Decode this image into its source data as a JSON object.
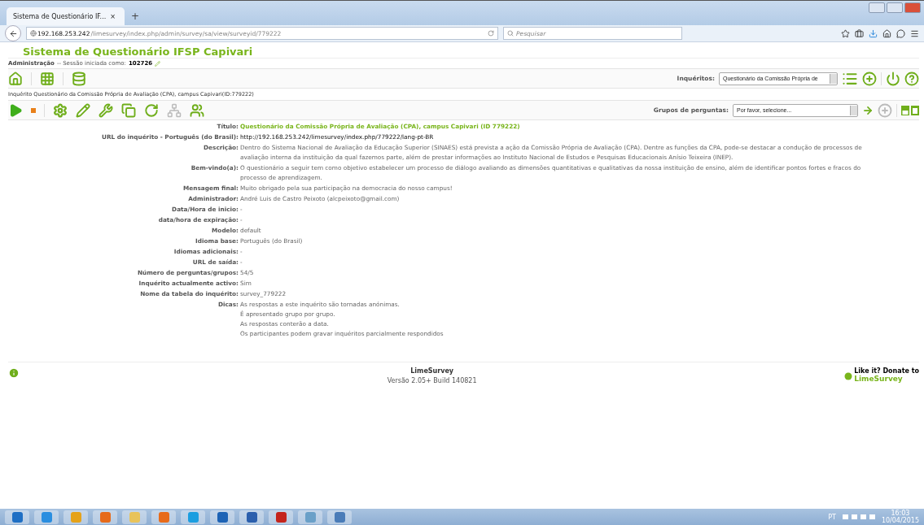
{
  "browser": {
    "tab_title": "Sistema de Questionário IF...",
    "tab_close": "×",
    "new_tab": "+",
    "url_host": "192.168.253.242",
    "url_path": "/limesurvey/index.php/admin/survey/sa/view/surveyid/779222",
    "search_placeholder": "Pesquisar"
  },
  "header": {
    "title": "Sistema de Questionário IFSP Capivari",
    "admin_label": "Administração",
    "session_text": "-- Sessão iniciada como:",
    "user": "102726"
  },
  "surveys": {
    "label": "Inquéritos:",
    "value": "Questionário da Comissão Própria de"
  },
  "survey_line": "Inquérito Questionário da Comissão Própria de Avaliação (CPA), campus Capivari(ID:779222)",
  "groups": {
    "label": "Grupos de perguntas:",
    "value": "Por favor, selecione..."
  },
  "details": [
    {
      "label": "Título:",
      "kind": "title",
      "lines": [
        "Questionário da Comissão Própria de Avaliação (CPA), campus Capivari (ID 779222)"
      ]
    },
    {
      "label": "URL do inquérito - Português (do Brasil):",
      "kind": "url",
      "lines": [
        "http://192.168.253.242/limesurvey/index.php/779222/lang-pt-BR"
      ]
    },
    {
      "label": "Descrição:",
      "kind": "text",
      "lines": [
        "Dentro do Sistema Nacional de Avaliação da Educação Superior (SINAES) está prevista a ação da Comissão Própria de Avaliação (CPA). Dentre as funções da CPA, pode-se destacar a condução de processos de",
        "avaliação interna da instituição da qual fazemos parte, além de prestar informações ao Instituto Nacional de Estudos e Pesquisas Educacionais Anísio Teixeira (INEP)."
      ]
    },
    {
      "label": "Bem-vindo(a):",
      "kind": "text",
      "lines": [
        "O questionário a seguir tem como objetivo estabelecer um processo de diálogo avaliando as dimensões quantitativas e qualitativas da nossa instituição de ensino, além de identificar pontos fortes e fracos do",
        "processo de aprendizagem."
      ]
    },
    {
      "label": "Mensagem final:",
      "kind": "text",
      "lines": [
        "Muito obrigado pela sua participação na democracia do nosso campus!"
      ]
    },
    {
      "label": "Administrador:",
      "kind": "text",
      "lines": [
        "André Luis de Castro Peixoto (alcpeixoto@gmail.com)"
      ]
    },
    {
      "label": "Data/Hora de inicio:",
      "kind": "text",
      "lines": [
        "-"
      ]
    },
    {
      "label": "data/hora de expiração:",
      "kind": "text",
      "lines": [
        "-"
      ]
    },
    {
      "label": "Modelo:",
      "kind": "text",
      "lines": [
        "default"
      ]
    },
    {
      "label": "Idioma base:",
      "kind": "text",
      "lines": [
        "Português (do Brasil)"
      ]
    },
    {
      "label": "Idiomas adicionais:",
      "kind": "text",
      "lines": [
        "-"
      ]
    },
    {
      "label": "URL de saída:",
      "kind": "text",
      "lines": [
        "-"
      ]
    },
    {
      "label": "Número de perguntas/grupos:",
      "kind": "text",
      "lines": [
        "54/5"
      ]
    },
    {
      "label": "Inquérito actualmente activo:",
      "kind": "text",
      "lines": [
        "Sim"
      ]
    },
    {
      "label": "Nome da tabela do inquérito:",
      "kind": "text",
      "lines": [
        "survey_779222"
      ]
    },
    {
      "label": "Dicas:",
      "kind": "text",
      "lines": [
        "As respostas a este inquérito são tornadas anónimas.",
        "É apresentado grupo por grupo.",
        "As respostas conterão a data.",
        "Os participantes podem gravar inquéritos parcialmente respondidos"
      ]
    }
  ],
  "footer": {
    "name": "LimeSurvey",
    "version": "Versão 2.05+ Build 140821",
    "donate_top": "Like it? Donate to",
    "donate_brand": "LimeSurvey"
  },
  "taskbar": {
    "language": "PT",
    "time": "16:03",
    "date": "10/04/2015"
  }
}
